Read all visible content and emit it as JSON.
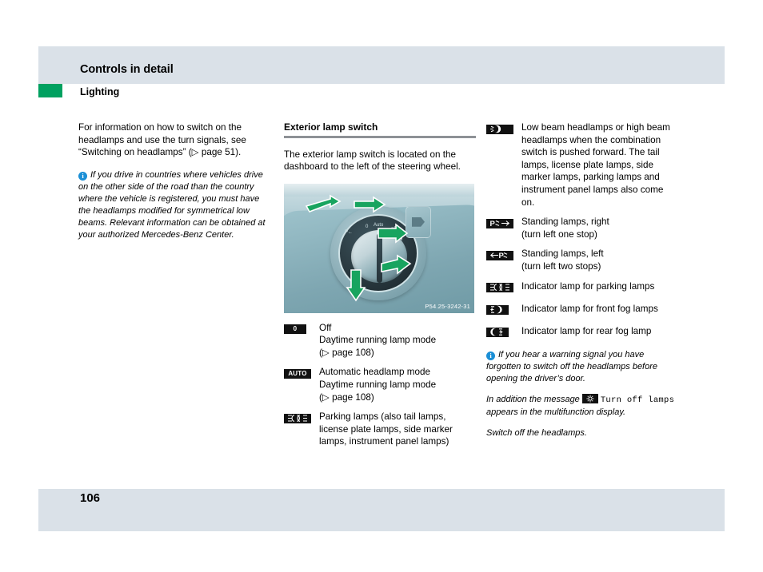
{
  "header": {
    "title": "Controls in detail",
    "section": "Lighting",
    "accent_color": "#00a160",
    "band_color": "#dae1e8"
  },
  "footer": {
    "page_number": "106"
  },
  "left_column": {
    "intro": "For information on how to switch on the headlamps and use the turn signals, see “Switching on headlamps” (▷ page 51).",
    "note_icon": "info-icon",
    "note": "If you drive in countries where vehicles drive on the other side of the road than the country where the vehicle is registered, you must have the headlamps modified for symmetrical low beams. Relevant information can be obtained at your authorized Mercedes-Benz Center."
  },
  "middle_column": {
    "heading": "Exterior lamp switch",
    "body": "The exterior lamp switch is located on the dashboard to the left of the steering wheel.",
    "figure": {
      "caption_code": "P54.25-3242-31",
      "alt": "Rotary exterior lamp switch on dashboard with green rotation arrows"
    },
    "legend": [
      {
        "icon": "lamp-switch-off-icon",
        "badge_text": "0",
        "badge_type": "text",
        "lines": [
          "Off",
          "Daytime running lamp mode",
          "(▷ page 108)"
        ]
      },
      {
        "icon": "lamp-switch-auto-icon",
        "badge_text": "AUTO",
        "badge_type": "text",
        "lines": [
          "Automatic headlamp mode",
          "Daytime running lamp mode",
          "(▷ page 108)"
        ]
      },
      {
        "icon": "parking-lamps-icon",
        "badge_text": "",
        "badge_type": "parking",
        "lines": [
          "Parking lamps (also tail lamps,",
          "license plate lamps, side marker",
          "lamps, instrument panel lamps)"
        ]
      }
    ]
  },
  "right_column": {
    "legend": [
      {
        "icon": "low-beam-headlamp-icon",
        "badge_type": "headlamp",
        "lines": [
          "Low beam headlamps or high beam",
          "headlamps when the combination",
          "switch is pushed forward. The tail",
          "lamps, license plate lamps, side",
          "marker lamps, parking lamps and",
          "instrument panel lamps also come",
          "on."
        ]
      },
      {
        "icon": "standing-lamps-right-icon",
        "badge_type": "standing-right",
        "lines": [
          "Standing lamps, right",
          "(turn left one stop)"
        ]
      },
      {
        "icon": "standing-lamps-left-icon",
        "badge_type": "standing-left",
        "lines": [
          "Standing lamps, left",
          "(turn left two stops)"
        ]
      },
      {
        "icon": "parking-lamps-indicator-icon",
        "badge_type": "parking",
        "lines": [
          "Indicator lamp for parking lamps"
        ]
      },
      {
        "icon": "front-fog-lamp-icon",
        "badge_type": "front-fog",
        "lines": [
          "Indicator lamp for front fog lamps"
        ]
      },
      {
        "icon": "rear-fog-lamp-icon",
        "badge_type": "rear-fog",
        "lines": [
          "Indicator lamp for rear fog lamp"
        ]
      }
    ],
    "note_icon": "info-icon",
    "note": "If you hear a warning signal you have forgotten to switch off the headlamps before opening the driver’s door.",
    "message_prefix": "In addition the message",
    "message_icon": "lamp-symbol-icon",
    "message_text": "Turn off lamps",
    "message_suffix": "appears in the multifunction display.",
    "action": "Switch off the headlamps."
  }
}
